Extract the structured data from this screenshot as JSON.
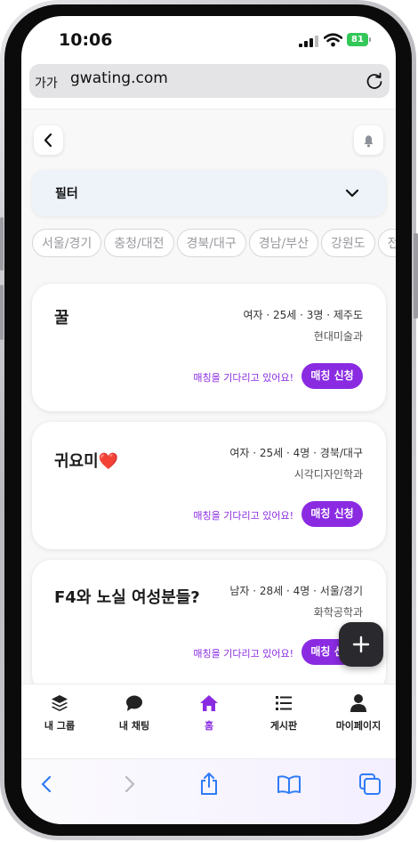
{
  "status": {
    "time": "10:06",
    "battery": "81"
  },
  "browser": {
    "text_size_label": "가가",
    "url": "gwating.com"
  },
  "filter": {
    "label": "필터"
  },
  "region_chips": [
    "서울/경기",
    "충청/대전",
    "경북/대구",
    "경남/부산",
    "강원도",
    "전라"
  ],
  "cards": [
    {
      "title": "꿀",
      "meta": "여자 · 25세 · 3명 · 제주도",
      "major": "현대미술과",
      "status": "매칭을 기다리고 있어요!",
      "button": "매칭 신청"
    },
    {
      "title": "귀요미❤️",
      "meta": "여자 · 25세 · 4명 · 경북/대구",
      "major": "시각디자인학과",
      "status": "매칭을 기다리고 있어요!",
      "button": "매칭 신청"
    },
    {
      "title": "F4와 노실 여성분들?",
      "meta": "남자 · 28세 · 4명 · 서울/경기",
      "major": "화학공학과",
      "status": "매칭을 기다리고 있어요!",
      "button": "매칭 신청"
    }
  ],
  "tabs": [
    {
      "label": "내 그룹",
      "icon": "layers-icon"
    },
    {
      "label": "내 채팅",
      "icon": "chat-bubble-icon"
    },
    {
      "label": "홈",
      "icon": "home-icon"
    },
    {
      "label": "게시판",
      "icon": "list-icon"
    },
    {
      "label": "마이페이지",
      "icon": "person-icon"
    }
  ],
  "colors": {
    "accent": "#8A2BE2",
    "fab": "#2A2A2E",
    "battery": "#34C759"
  }
}
